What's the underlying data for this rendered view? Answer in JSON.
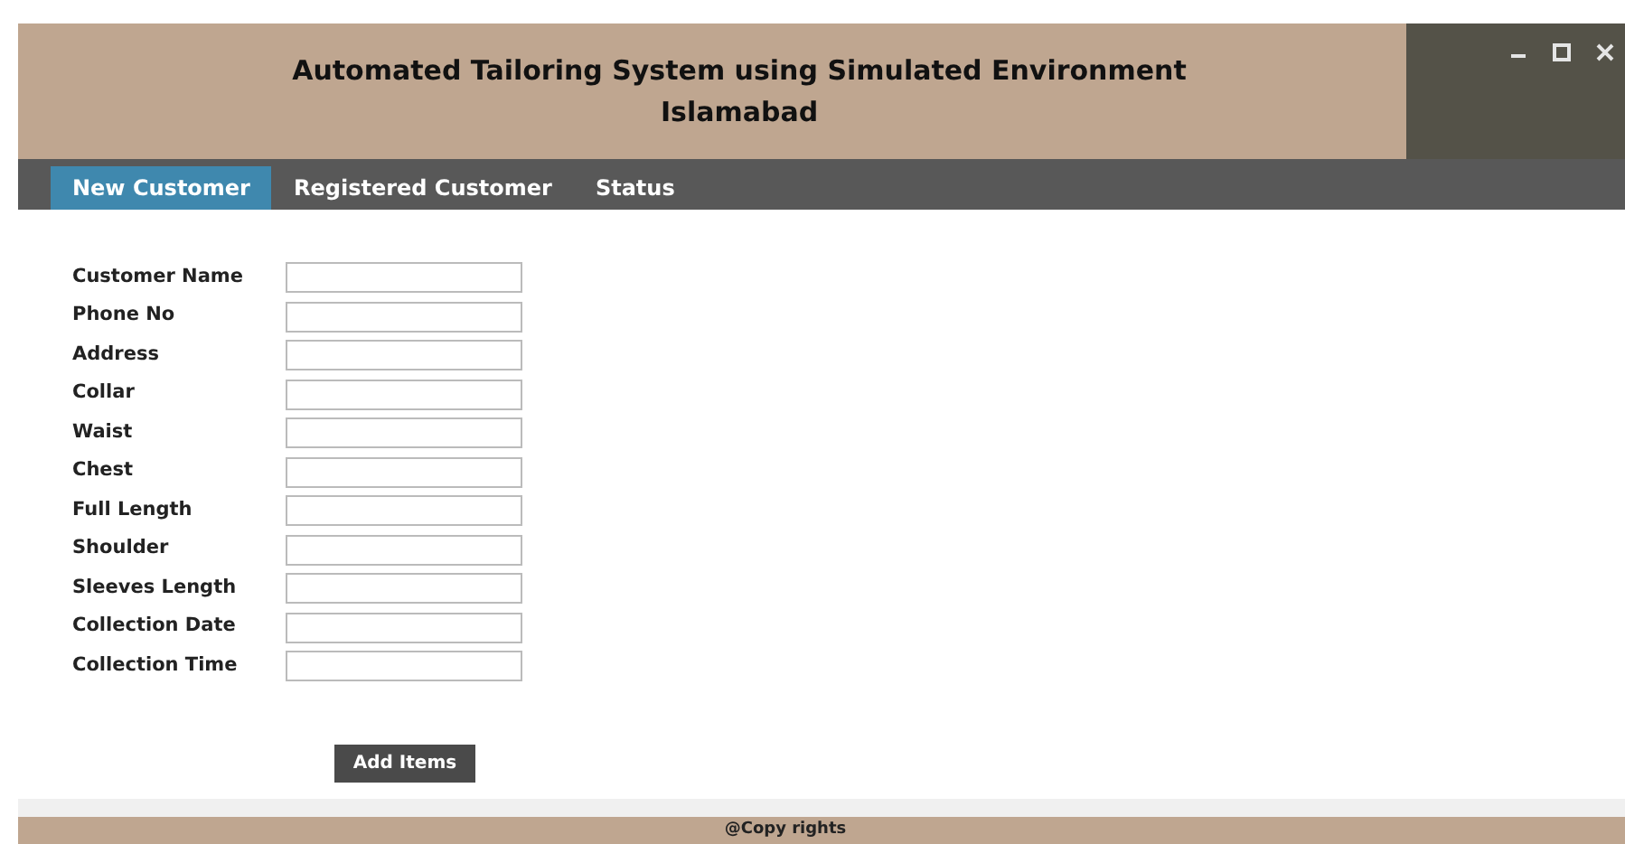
{
  "header": {
    "title": "Automated Tailoring System using Simulated Environment",
    "subtitle": "Islamabad"
  },
  "tabs": [
    {
      "label": "New Customer",
      "selected": true
    },
    {
      "label": "Registered Customer",
      "selected": false
    },
    {
      "label": "Status",
      "selected": false
    }
  ],
  "form": {
    "fields": [
      {
        "label": "Customer Name"
      },
      {
        "label": "Phone No"
      },
      {
        "label": "Address"
      },
      {
        "label": "Collar"
      },
      {
        "label": "Waist"
      },
      {
        "label": "Chest"
      },
      {
        "label": "Full Length"
      },
      {
        "label": "Shoulder"
      },
      {
        "label": "Sleeves Length"
      },
      {
        "label": "Collection Date"
      },
      {
        "label": "Collection Time"
      }
    ],
    "button": "Add Items"
  },
  "footer": "@Copy rights"
}
